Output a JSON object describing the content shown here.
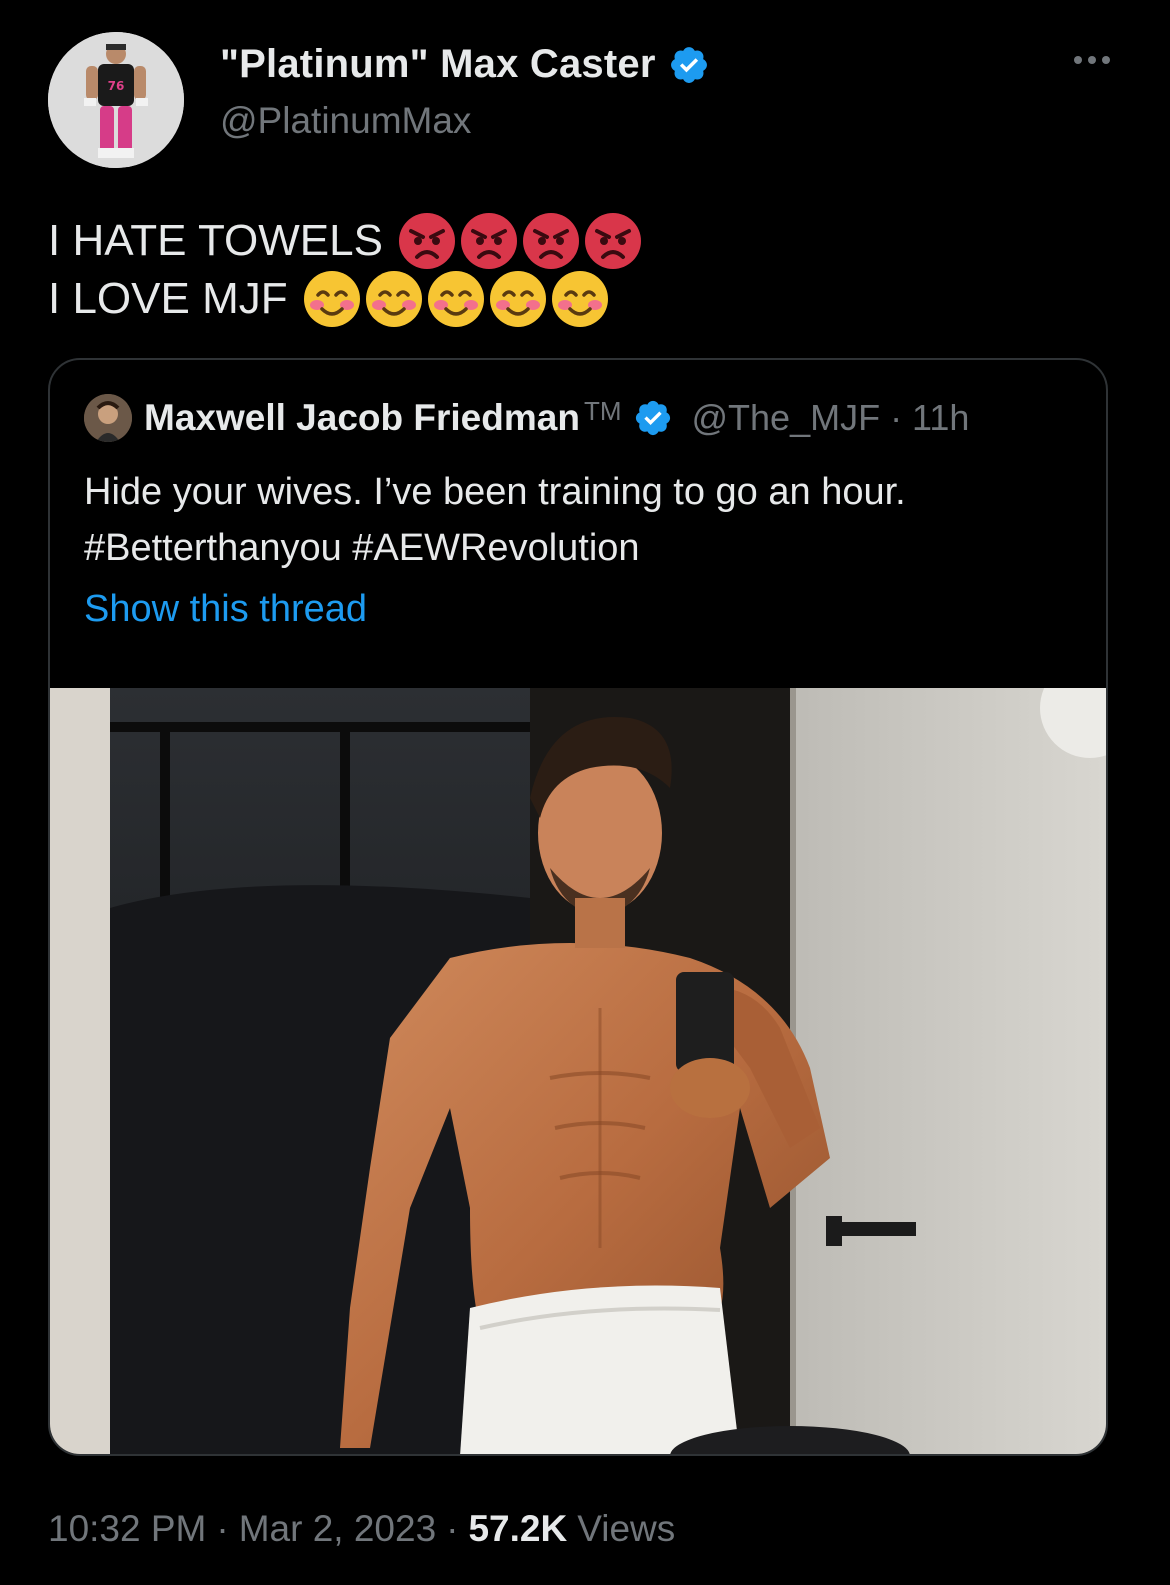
{
  "author": {
    "display_name": "\"Platinum\" Max Caster",
    "handle": "@PlatinumMax",
    "verified_icon": "verified-badge-icon"
  },
  "tweet": {
    "line1_text": "I HATE TOWELS",
    "line1_emoji": [
      "angry-face-icon",
      "angry-face-icon",
      "angry-face-icon",
      "angry-face-icon"
    ],
    "line2_text": "I LOVE MJF",
    "line2_emoji": [
      "smiling-blush-icon",
      "smiling-blush-icon",
      "smiling-blush-icon",
      "smiling-blush-icon",
      "smiling-blush-icon"
    ]
  },
  "quoted": {
    "display_name": "Maxwell Jacob Friedman",
    "trademark": "TM",
    "handle_time": "@The_MJF · 11h",
    "body_line1": "Hide your wives. I’ve been training to go an hour.",
    "body_line2": "#Betterthanyou #AEWRevolution",
    "show_thread": "Show this thread",
    "media_description_icon": "photo-mirror-selfie"
  },
  "footer": {
    "time": "10:32 PM",
    "sep1": "·",
    "date": "Mar 2, 2023",
    "sep2": "·",
    "views_count": "57.2K",
    "views_label": "Views"
  },
  "colors": {
    "background": "#000000",
    "text": "#e7e9ea",
    "muted": "#71767b",
    "link": "#1d9bf0",
    "verified": "#1d9bf0",
    "border": "#2f3336"
  }
}
